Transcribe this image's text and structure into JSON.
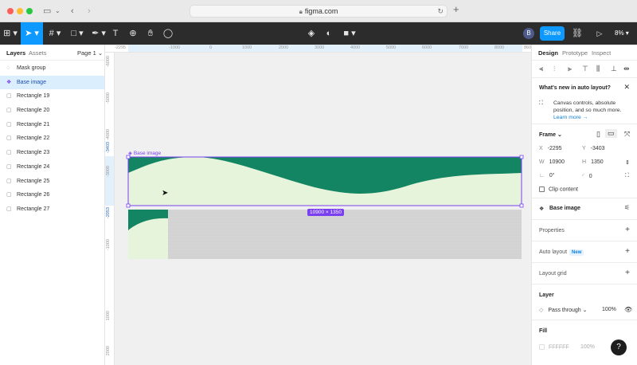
{
  "browser": {
    "url": "figma.com",
    "lock_icon": "lock-icon",
    "reload_icon": "reload-icon"
  },
  "toolbar": {
    "share_label": "Share",
    "avatar_initial": "B",
    "zoom": "8%"
  },
  "left_panel": {
    "tab_layers": "Layers",
    "tab_assets": "Assets",
    "page": "Page 1",
    "layers": [
      {
        "label": "Mask group",
        "icon": "mask-icon"
      },
      {
        "label": "Base image",
        "icon": "component-icon",
        "selected": true
      },
      {
        "label": "Rectangle 19",
        "icon": "rectangle-icon"
      },
      {
        "label": "Rectangle 20",
        "icon": "rectangle-icon"
      },
      {
        "label": "Rectangle 21",
        "icon": "rectangle-icon"
      },
      {
        "label": "Rectangle 22",
        "icon": "rectangle-icon"
      },
      {
        "label": "Rectangle 23",
        "icon": "rectangle-icon"
      },
      {
        "label": "Rectangle 24",
        "icon": "rectangle-icon"
      },
      {
        "label": "Rectangle 25",
        "icon": "rectangle-icon"
      },
      {
        "label": "Rectangle 26",
        "icon": "rectangle-icon"
      },
      {
        "label": "Rectangle 27",
        "icon": "rectangle-icon"
      }
    ]
  },
  "rulers": {
    "top": [
      "-2295",
      "-1000",
      "0",
      "1000",
      "2000",
      "3000",
      "4000",
      "5000",
      "6000",
      "7000",
      "8000",
      "860"
    ],
    "left": [
      "-6000",
      "-5000",
      "-4000",
      "-3403",
      "-3000",
      "-2053",
      "-1000",
      "1000",
      "2000"
    ]
  },
  "canvas": {
    "frame_label": "Base image",
    "size_label": "10900 × 1350",
    "colors": {
      "green": "#148562",
      "light": "#e7f4dc",
      "gray": "#d4d4d4",
      "selection": "#7a3ff0"
    }
  },
  "right_panel": {
    "tab_design": "Design",
    "tab_prototype": "Prototype",
    "tab_inspect": "Inspect",
    "whats_new": {
      "title": "What's new in auto layout?",
      "text": "Canvas controls, absolute position, and so much more.",
      "link": "Learn more →"
    },
    "frame": {
      "title": "Frame",
      "x_label": "X",
      "x": "-2295",
      "y_label": "Y",
      "y": "-3403",
      "w_label": "W",
      "w": "10900",
      "h_label": "H",
      "h": "1350",
      "rotation": "0°",
      "radius": "0",
      "clip": "Clip content"
    },
    "component": "Base image",
    "properties": "Properties",
    "auto_layout": "Auto layout",
    "new_badge": "New",
    "layout_grid": "Layout grid",
    "layer": {
      "title": "Layer",
      "blend": "Pass through",
      "opacity": "100%"
    },
    "fill": {
      "title": "Fill",
      "hex": "FFFFFF",
      "opacity": "100%"
    },
    "help": "?"
  }
}
